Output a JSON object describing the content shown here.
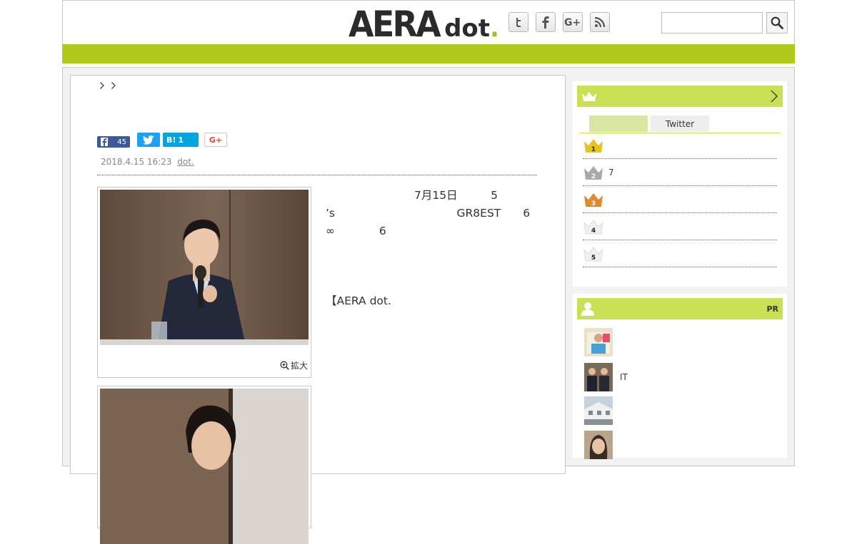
{
  "header": {
    "logo_main": "AERA",
    "logo_sub": "dot",
    "logo_period": ".",
    "social": [
      {
        "icon": "twitter-icon",
        "glyph": "t"
      },
      {
        "icon": "facebook-icon",
        "glyph": "f"
      },
      {
        "icon": "google-plus-icon",
        "glyph": "G+"
      },
      {
        "icon": "rss-icon",
        "glyph": "rss"
      }
    ],
    "search": {
      "value": "",
      "placeholder": ""
    }
  },
  "colors": {
    "accent_green": "#afc91b",
    "sidebar_header_green": "#c9df54",
    "facebook": "#3b5998",
    "twitter": "#1da1f2",
    "hatena": "#00a4de"
  },
  "article": {
    "share": {
      "facebook_count": "45",
      "hatena_label": "B!",
      "hatena_count": "1",
      "gplus_label": "G+"
    },
    "date": "2018.4.15 16:23",
    "source": "dot.",
    "zoom_label": "拡大",
    "paragraphs": [
      "　　　　　　　　7月15日　　　5　　　　　　　　　　　　’s　　　　　　　　　　　GR8EST　　6　　　　　　　　　　　　　　　　　　　　　　　　　　　∞　　　　6　　　　　　　　　",
      "　　　　　　　　　　　　　　　　　　　　　　　　　　　　　　　　　　　　　　　　　　　　　　　　　　　　　　　　　　　　　　　　　　　　　　　　　　　　　　　　　　　　　　　　　　　　　　　　　　　　　　　　　　　　　　　　　　　　　　　　　　　　",
      "【AERA dot.　　　　　　　　　"
    ]
  },
  "ranking": {
    "tabs": [
      "",
      "Twitter"
    ],
    "items": [
      {
        "rank": "1",
        "text": ""
      },
      {
        "rank": "2",
        "text": "7"
      },
      {
        "rank": "3",
        "text": ""
      },
      {
        "rank": "4",
        "text": ""
      },
      {
        "rank": "5",
        "text": ""
      }
    ]
  },
  "pr": {
    "label": "PR",
    "items": [
      {
        "text": ""
      },
      {
        "text": "IT"
      },
      {
        "text": ""
      },
      {
        "text": ""
      }
    ]
  }
}
